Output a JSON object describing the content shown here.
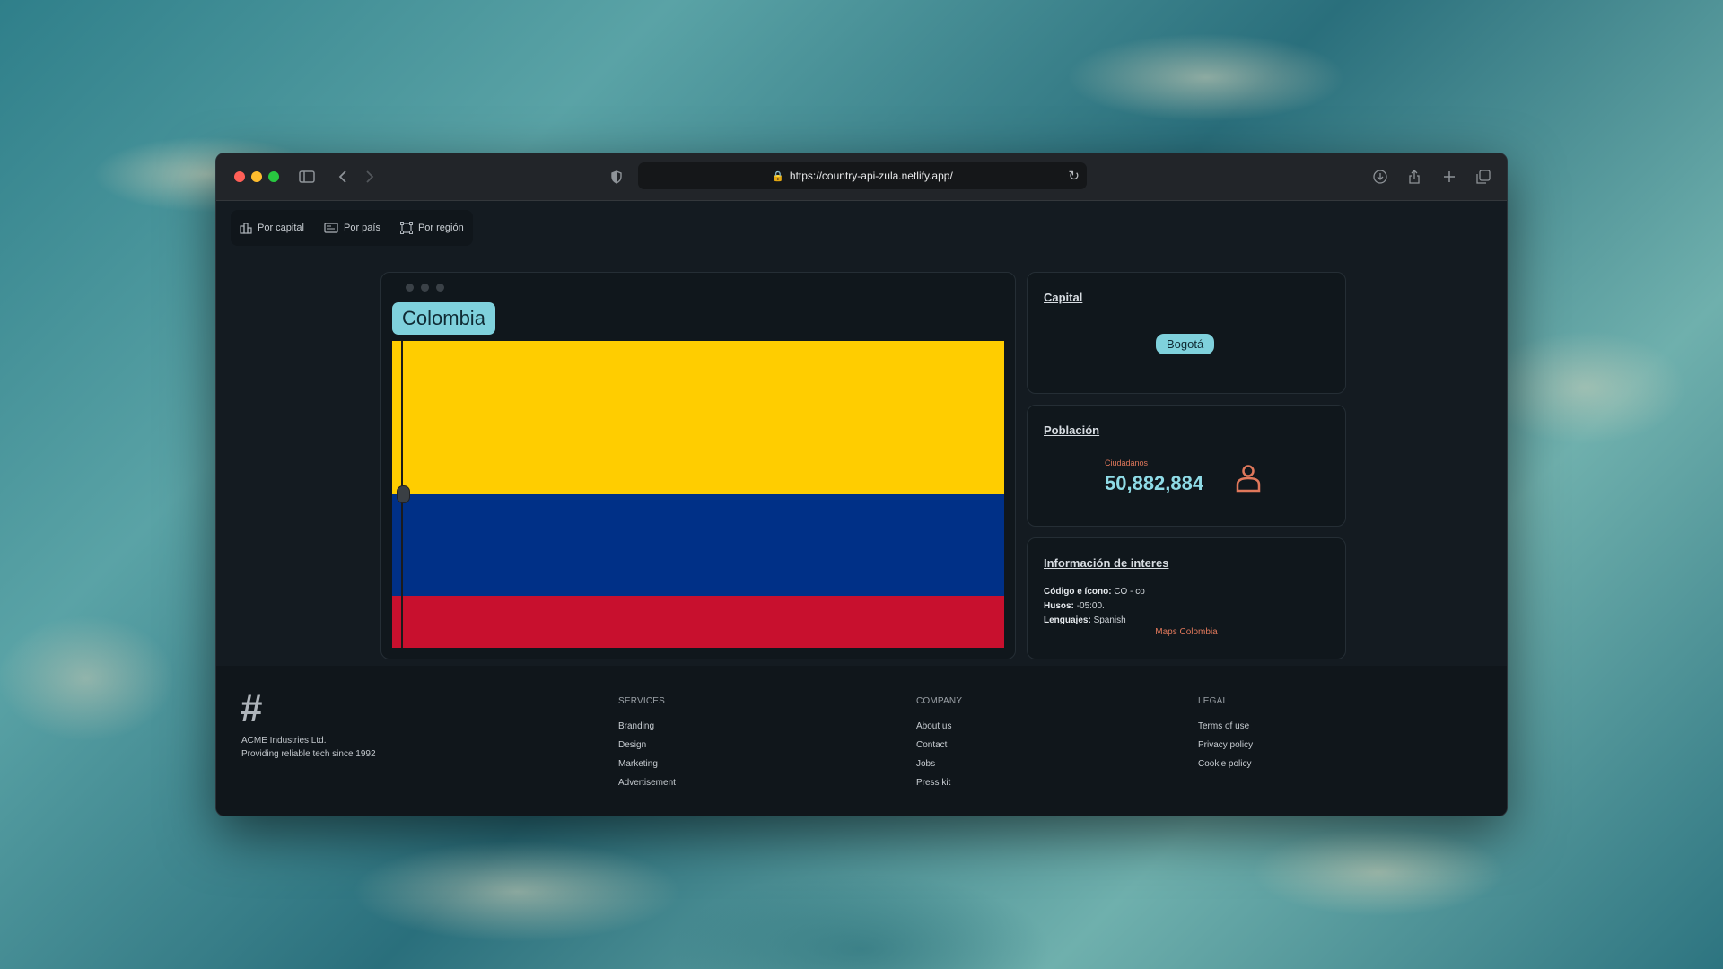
{
  "browser": {
    "url": "https://country-api-zula.netlify.app/",
    "traffic_lights": [
      "#ff5f57",
      "#febc2e",
      "#28c840"
    ]
  },
  "nav": {
    "tabs": [
      {
        "label": "Por capital",
        "icon": "city-icon"
      },
      {
        "label": "Por país",
        "icon": "flag-icon"
      },
      {
        "label": "Por región",
        "icon": "region-icon"
      }
    ]
  },
  "country": {
    "name": "Colombia",
    "flag_colors": [
      "#FFCD00",
      "#003087",
      "#C8102E"
    ],
    "flag_ratios": [
      0.5,
      0.33,
      0.17
    ]
  },
  "capital": {
    "title": "Capital",
    "value": "Bogotá"
  },
  "population": {
    "title": "Población",
    "label": "Ciudadanos",
    "value": "50,882,884"
  },
  "info": {
    "title": "Información de interes",
    "code_label": "Código e ícono:",
    "code_value": "CO - co",
    "timezone_label": "Husos:",
    "timezone_value": "-05:00.",
    "languages_label": "Lenguajes:",
    "languages_value": "Spanish",
    "maps_link": "Maps Colombia"
  },
  "footer": {
    "logo_symbol": "#",
    "company_name": "ACME Industries Ltd.",
    "tagline": "Providing reliable tech since 1992",
    "columns": [
      {
        "title": "SERVICES",
        "links": [
          "Branding",
          "Design",
          "Marketing",
          "Advertisement"
        ]
      },
      {
        "title": "COMPANY",
        "links": [
          "About us",
          "Contact",
          "Jobs",
          "Press kit"
        ]
      },
      {
        "title": "LEGAL",
        "links": [
          "Terms of use",
          "Privacy policy",
          "Cookie policy"
        ]
      }
    ]
  }
}
